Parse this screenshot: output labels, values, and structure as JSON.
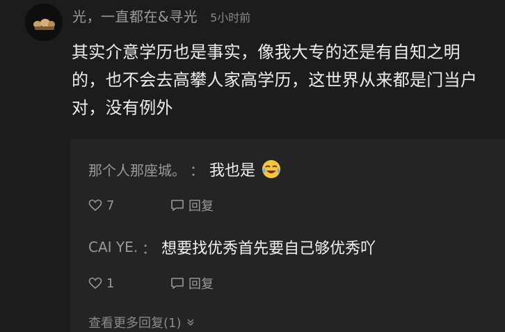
{
  "comment": {
    "author": "光，一直都在&寻光",
    "timestamp": "5小时前",
    "text": "其实介意学历也是事实，像我大专的还是有自知之明的，也不会去高攀人家高学历，这世界从来都是门当户对，没有例外"
  },
  "replies": [
    {
      "author": "那个人那座城。",
      "separator": "：",
      "text": "我也是",
      "emoji": "crying-laughing-emoji",
      "likes": "7",
      "reply_label": "回复"
    },
    {
      "author": "CAI YE.",
      "separator": "：",
      "text": "想要找优秀首先要自己够优秀吖",
      "likes": "1",
      "reply_label": "回复"
    }
  ],
  "more_replies_label": "查看更多回复(1)",
  "icons": {
    "like": "heart-outline-icon",
    "reply": "speech-bubble-icon",
    "expand": "chevron-down-double-icon"
  },
  "colors": {
    "background": "#1c1c1c",
    "reply_panel": "#242424",
    "muted_text": "#9a9a9a",
    "body_text": "#ececec"
  }
}
